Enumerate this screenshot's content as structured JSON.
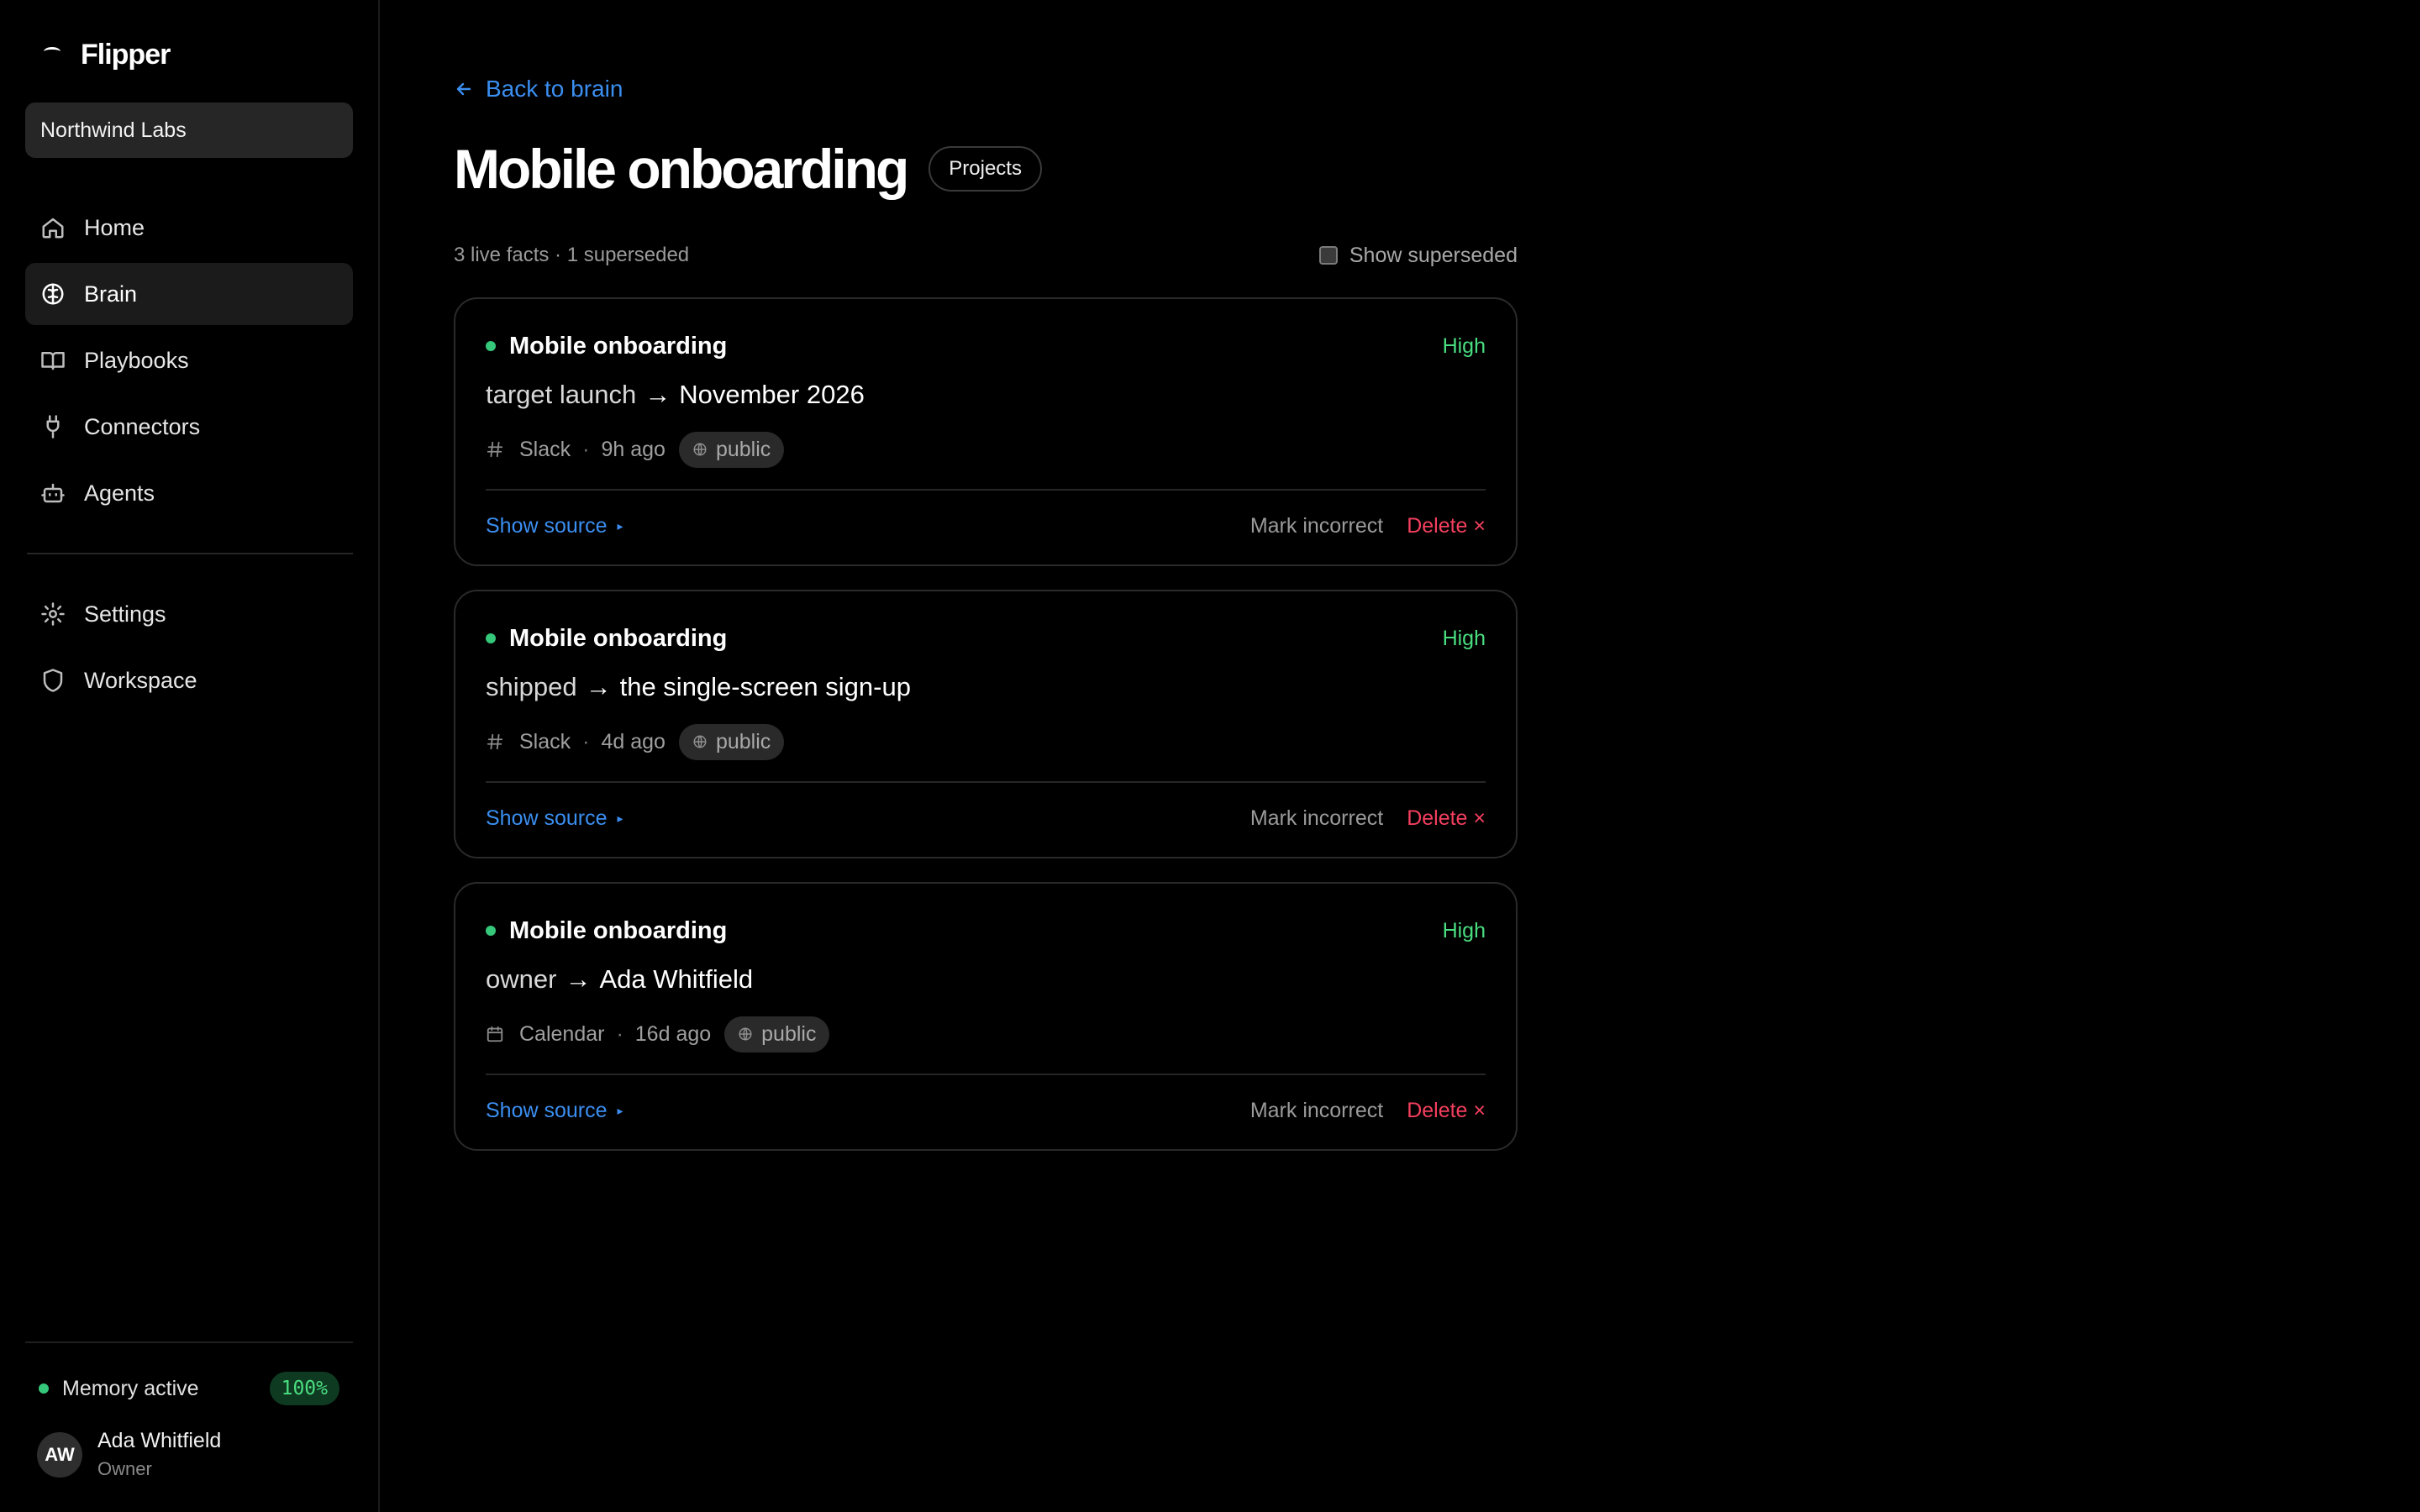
{
  "brand": {
    "name": "Flipper"
  },
  "workspace": {
    "name": "Northwind Labs"
  },
  "nav": {
    "items": [
      {
        "label": "Home",
        "icon": "home-icon"
      },
      {
        "label": "Brain",
        "icon": "brain-icon",
        "active": true
      },
      {
        "label": "Playbooks",
        "icon": "book-icon"
      },
      {
        "label": "Connectors",
        "icon": "plug-icon"
      },
      {
        "label": "Agents",
        "icon": "robot-icon"
      }
    ],
    "secondary": [
      {
        "label": "Settings",
        "icon": "gear-icon"
      },
      {
        "label": "Workspace",
        "icon": "shield-icon"
      }
    ]
  },
  "footer": {
    "memory_label": "Memory active",
    "memory_value": "100%",
    "user": {
      "initials": "AW",
      "name": "Ada Whitfield",
      "role": "Owner"
    }
  },
  "main": {
    "back_label": "Back to brain",
    "title": "Mobile onboarding",
    "category": "Projects",
    "stats": "3 live facts · 1 superseded",
    "toggle_label": "Show superseded",
    "cards": [
      {
        "entity": "Mobile onboarding",
        "confidence": "High",
        "key": "target launch",
        "arrow": "→",
        "value": "November 2026",
        "source_icon": "hash-icon",
        "source": "Slack",
        "sep": "·",
        "age": "9h ago",
        "visibility": "public",
        "show_source": "Show source",
        "mark_incorrect": "Mark incorrect",
        "delete": "Delete ×"
      },
      {
        "entity": "Mobile onboarding",
        "confidence": "High",
        "key": "shipped",
        "arrow": "→",
        "value": "the single-screen sign-up",
        "source_icon": "hash-icon",
        "source": "Slack",
        "sep": "·",
        "age": "4d ago",
        "visibility": "public",
        "show_source": "Show source",
        "mark_incorrect": "Mark incorrect",
        "delete": "Delete ×"
      },
      {
        "entity": "Mobile onboarding",
        "confidence": "High",
        "key": "owner",
        "arrow": "→",
        "value": "Ada Whitfield",
        "source_icon": "calendar-icon",
        "source": "Calendar",
        "sep": "·",
        "age": "16d ago",
        "visibility": "public",
        "show_source": "Show source",
        "mark_incorrect": "Mark incorrect",
        "delete": "Delete ×"
      }
    ]
  },
  "colors": {
    "accent": "#3b8ef0",
    "success": "#4ade80",
    "danger": "#f43f5e"
  }
}
